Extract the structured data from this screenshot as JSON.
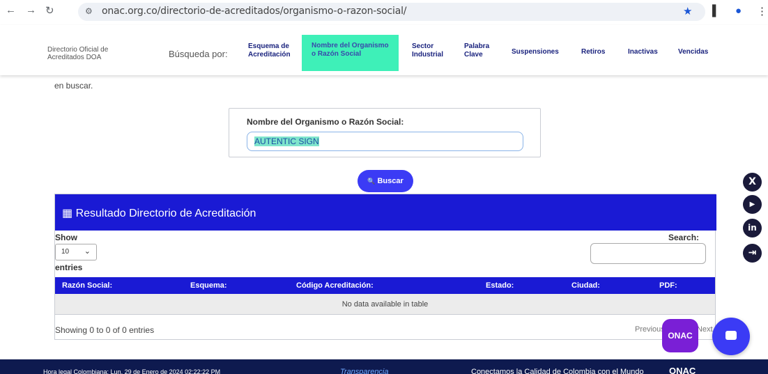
{
  "browser": {
    "url": "onac.org.co/directorio-de-acreditados/organismo-o-razon-social/",
    "back_icon": "←",
    "forward_icon": "→",
    "reload_icon": "↻",
    "site_info_icon": "⚙",
    "bookmark_icon": "★",
    "sidebar_icon": "▌",
    "profile_icon": "●",
    "menu_icon": "⋮"
  },
  "header": {
    "brand_line1": "Directorio Oficial de",
    "brand_line2": "Acreditados DOA",
    "search_by": "Búsqueda por:",
    "nav": [
      {
        "line1": "Esquema de",
        "line2": "Acreditación"
      },
      {
        "line1": "Nombre del Organismo",
        "line2": "o Razón Social"
      },
      {
        "line1": "Sector",
        "line2": "Industrial"
      },
      {
        "line1": "Palabra",
        "line2": "Clave"
      },
      {
        "line1": "Suspensiones",
        "line2": ""
      },
      {
        "line1": "Retiros",
        "line2": ""
      },
      {
        "line1": "Inactivas",
        "line2": ""
      },
      {
        "line1": "Vencidas",
        "line2": ""
      }
    ]
  },
  "intro_text": "en buscar.",
  "search_form": {
    "label": "Nombre del Organismo o Razón Social:",
    "value": "AUTENTIC SIGN",
    "button": "Buscar",
    "button_icon": "🔍"
  },
  "results": {
    "title": "Resultado Directorio de Acreditación",
    "title_icon": "▦",
    "show": "Show",
    "entries_value": "10",
    "entries": "entries",
    "search_label": "Search:",
    "columns": [
      "Razón Social:",
      "Esquema:",
      "Código Acreditación:",
      "Estado:",
      "Ciudad:",
      "PDF:"
    ],
    "empty": "No data available in table",
    "showing": "Showing 0 to 0 of 0 entries",
    "previous": "Previous",
    "next": "Next"
  },
  "social": [
    "X",
    "▶",
    "in",
    "⇥"
  ],
  "onac_badge": "ONAC",
  "footer": {
    "left": "Hora legal Colombiana: Lun, 29 de Enero de 2024 02:22:22 PM",
    "middle": "Transparencia",
    "right": "Conectamos la Calidad de Colombia con el Mundo",
    "logo": "ONAC"
  }
}
